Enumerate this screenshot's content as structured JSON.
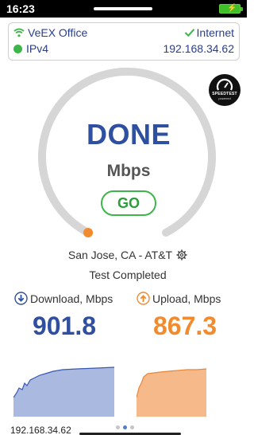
{
  "status_bar": {
    "time": "16:23"
  },
  "network": {
    "ssid": "VeEX Office",
    "connection_status": "Internet",
    "ip_version": "IPv4",
    "ip_address": "192.168.34.62"
  },
  "speedtest": {
    "brand": "SPEEDTEST",
    "brand_sub": "powered",
    "state": "DONE",
    "unit": "Mbps",
    "go_label": "GO",
    "gauge_level": 0
  },
  "server": {
    "location": "San Jose, CA - AT&T",
    "status": "Test Completed"
  },
  "results": {
    "download_label": "Download, Mbps",
    "download_value": "901.8",
    "upload_label": "Upload, Mbps",
    "upload_value": "867.3"
  },
  "graphs": {
    "download_color": "#a9b9e0",
    "download_line": "#3a58b0",
    "upload_color": "#f6b98a",
    "upload_line": "#e8873a"
  },
  "footer": {
    "ip": "192.168.34.62",
    "page_count": 3,
    "active_page": 2
  },
  "colors": {
    "accent_blue": "#2f4fa0",
    "accent_orange": "#f28a2e",
    "accent_green": "#3db54a",
    "gauge_track": "#d6d6d6"
  }
}
